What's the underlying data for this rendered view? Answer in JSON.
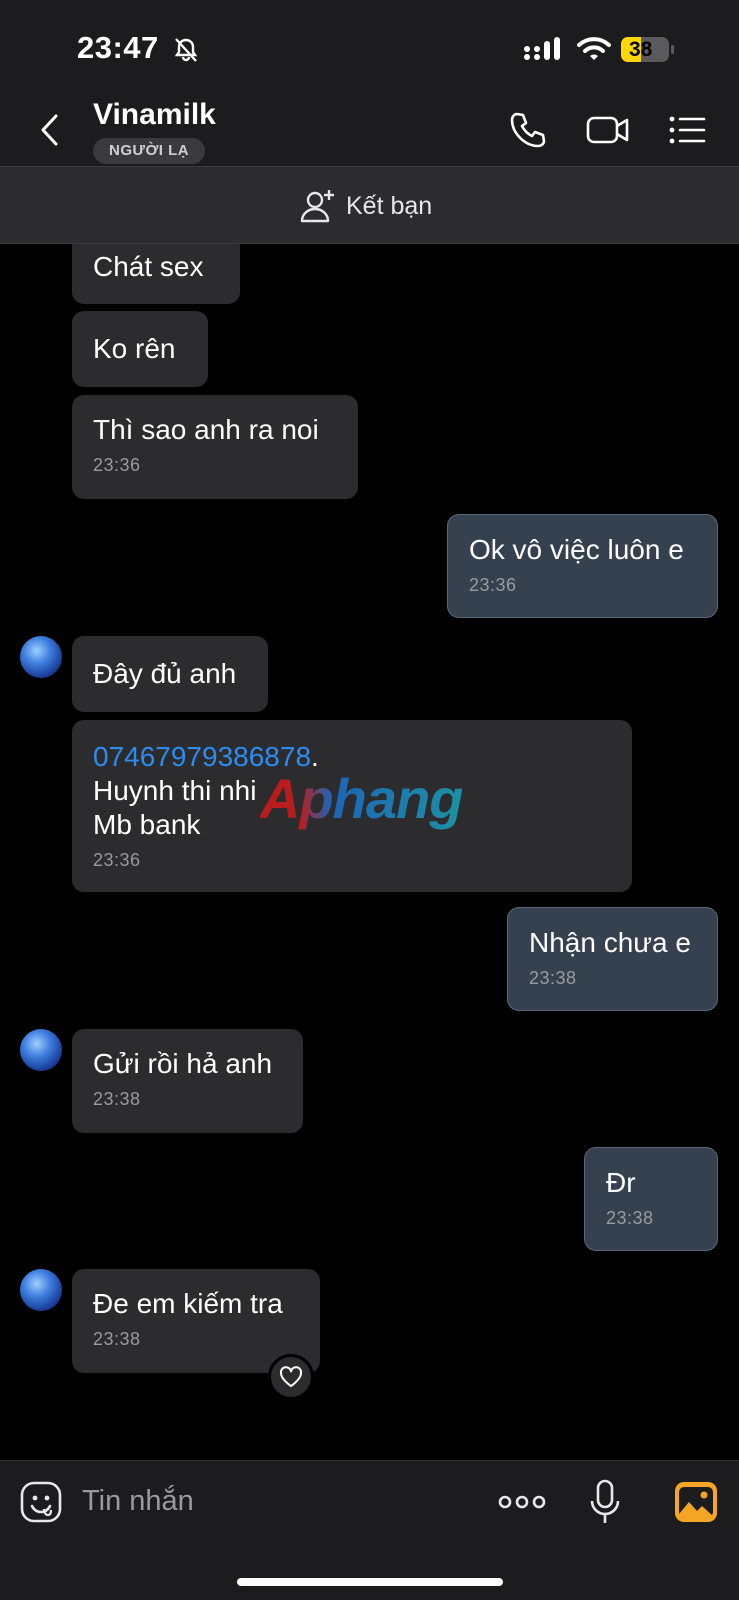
{
  "status_bar": {
    "time": "23:47",
    "battery": "38",
    "icons": [
      "bell-slash-icon",
      "signal-icon",
      "wifi-icon",
      "battery-icon"
    ]
  },
  "header": {
    "title": "Vinamilk",
    "badge": "NGƯỜI LẠ",
    "icons": [
      "back-icon",
      "phone-icon",
      "video-icon",
      "menu-icon"
    ]
  },
  "friend_bar": {
    "label": "Kết bạn",
    "icon": "add-friend-icon"
  },
  "messages": [
    {
      "side": "in",
      "text": "Chát sex",
      "time": ""
    },
    {
      "side": "in",
      "text": "Ko rên",
      "time": ""
    },
    {
      "side": "in",
      "text": "Thì sao anh ra noi",
      "time": "23:36"
    },
    {
      "side": "out",
      "text": "Ok vô việc luôn e",
      "time": "23:36"
    },
    {
      "side": "in",
      "text": "Đây đủ anh",
      "time": ""
    },
    {
      "side": "in",
      "link": "07467979386878",
      "link_suffix": ".",
      "text": "Huynh thi nhi\nMb bank",
      "time": "23:36"
    },
    {
      "side": "out",
      "text": "Nhận chưa e",
      "time": "23:38"
    },
    {
      "side": "in",
      "text": "Gửi rồi hả anh",
      "time": "23:38"
    },
    {
      "side": "out",
      "text": "Đr",
      "time": "23:38"
    },
    {
      "side": "in",
      "text": "Đe em kiếm tra",
      "time": "23:38"
    }
  ],
  "watermark": "Aphang",
  "composer": {
    "placeholder": "Tin nhắn",
    "icons": [
      "emoji-icon",
      "more-icon",
      "mic-icon",
      "gallery-icon"
    ]
  },
  "colors": {
    "background": "#000000",
    "bar": "#1c1c1e",
    "incoming_bubble": "#2c2c2e",
    "outgoing_bubble": "#364150",
    "link": "#2d8cf0",
    "gallery_accent": "#f5a524",
    "battery_accent": "#ffd60a"
  }
}
